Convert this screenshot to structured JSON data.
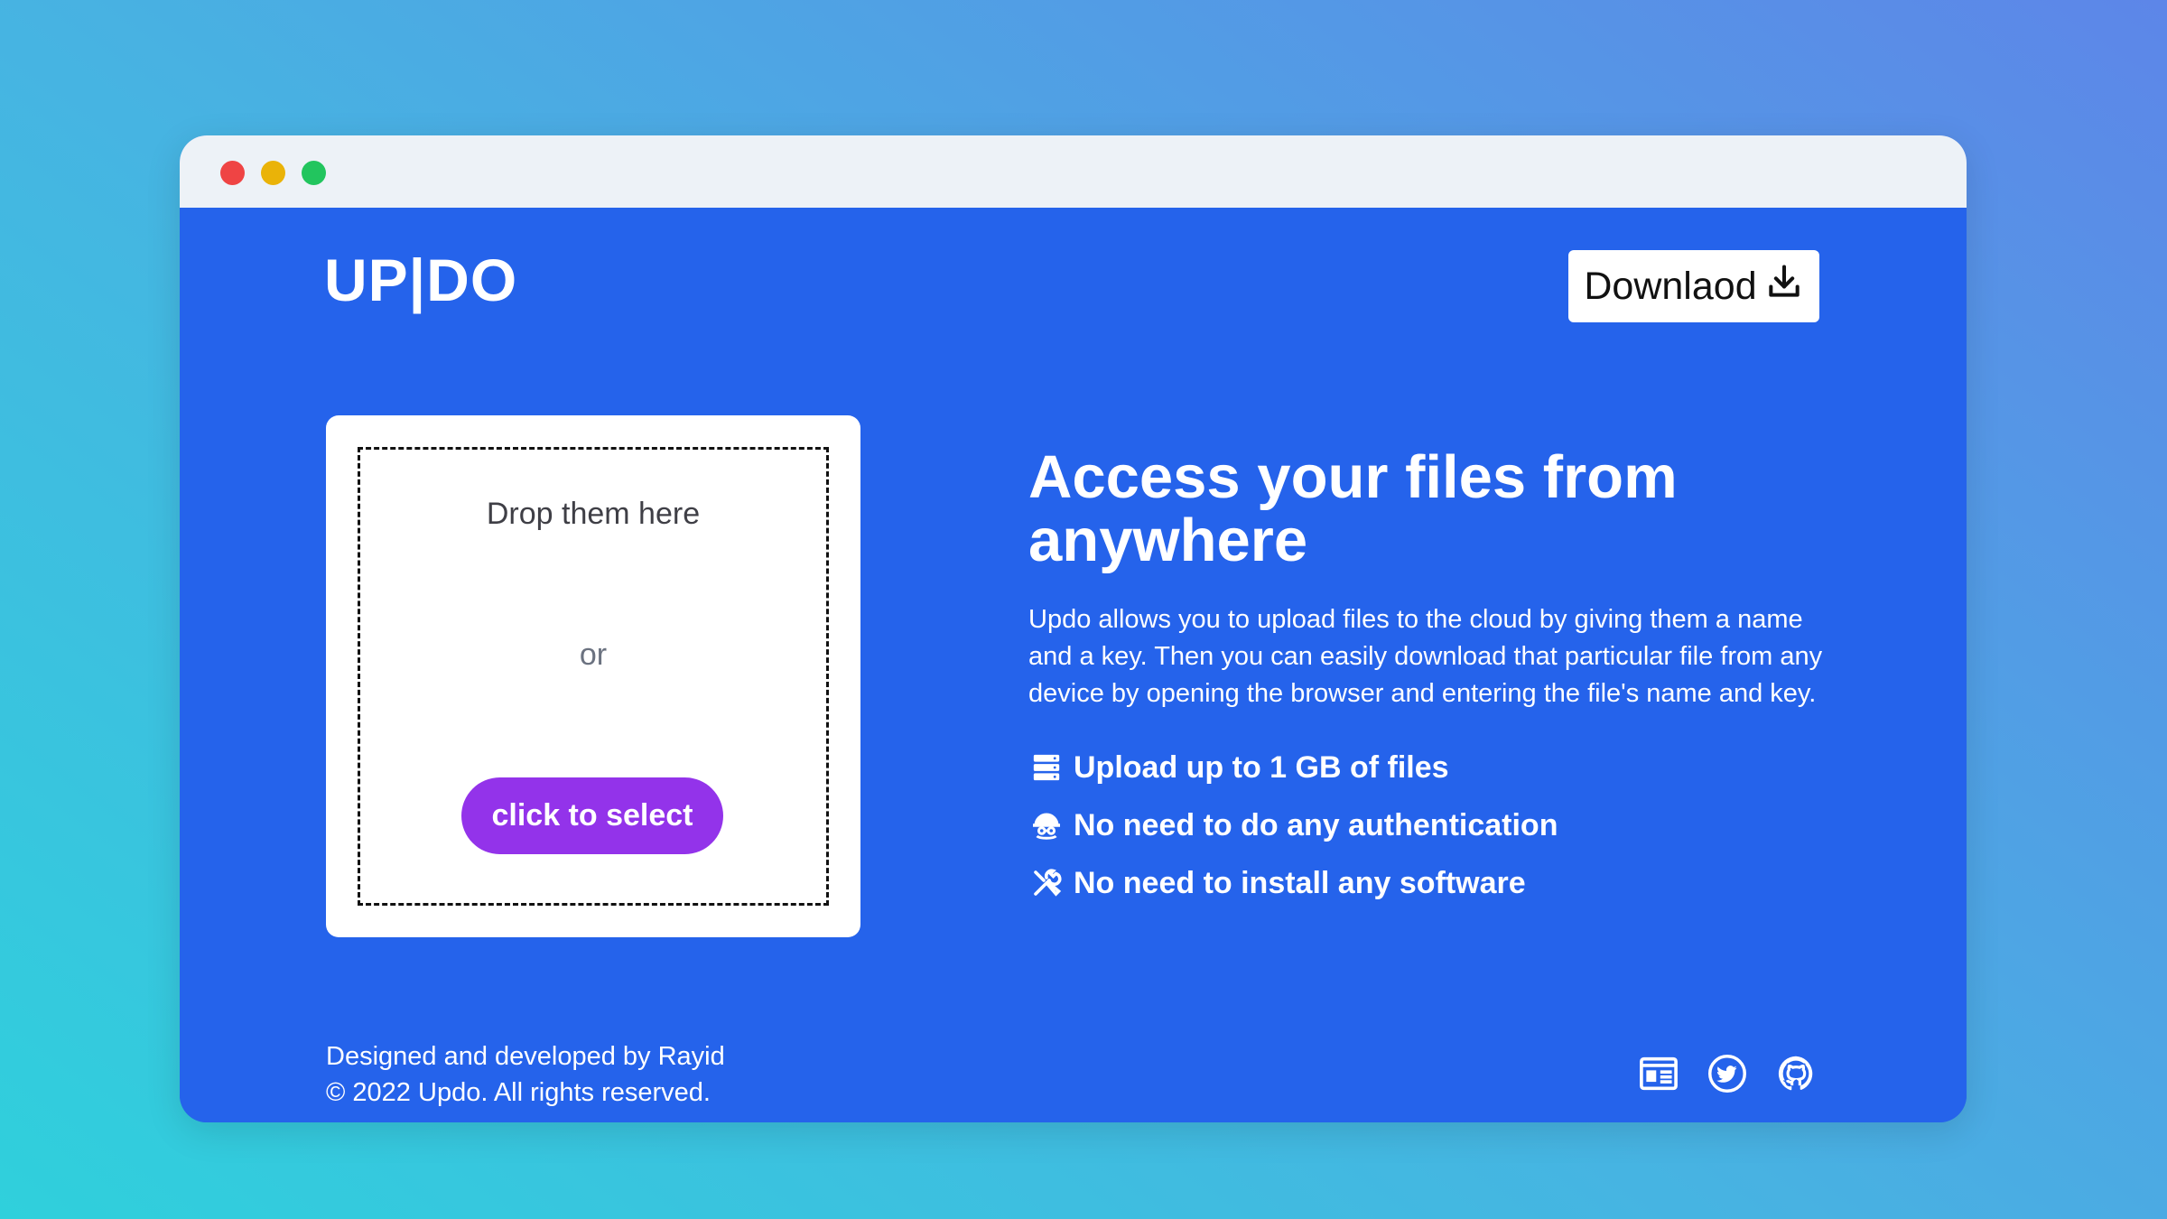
{
  "window": {
    "controls": {
      "close_color": "#ef4444",
      "minimize_color": "#eab308",
      "maximize_color": "#22c55e"
    }
  },
  "header": {
    "logo": "UP|DO",
    "download_label": "Downlaod",
    "download_icon": "download-icon"
  },
  "upload": {
    "drop_text": "Drop them here",
    "or_text": "or",
    "select_label": "click to select",
    "select_color": "#9333ea"
  },
  "hero": {
    "headline": "Access your files from anywhere",
    "description": "Updo allows you to upload files to the cloud by giving them a name and a key. Then you can easily download that particular file from any device by opening the browser and entering the file's name and key.",
    "features": [
      {
        "icon": "server-icon",
        "label": "Upload up to 1 GB of files"
      },
      {
        "icon": "user-secret-icon",
        "label": "No need to do any authentication"
      },
      {
        "icon": "tools-icon",
        "label": "No need to install any software"
      }
    ]
  },
  "footer": {
    "credit": "Designed and developed by Rayid",
    "copyright": "© 2022 Updo. All rights reserved.",
    "social_icons": [
      "blog-icon",
      "twitter-icon",
      "github-icon"
    ]
  },
  "colors": {
    "background_accent": "#2563eb",
    "titlebar": "#edf2f7"
  }
}
